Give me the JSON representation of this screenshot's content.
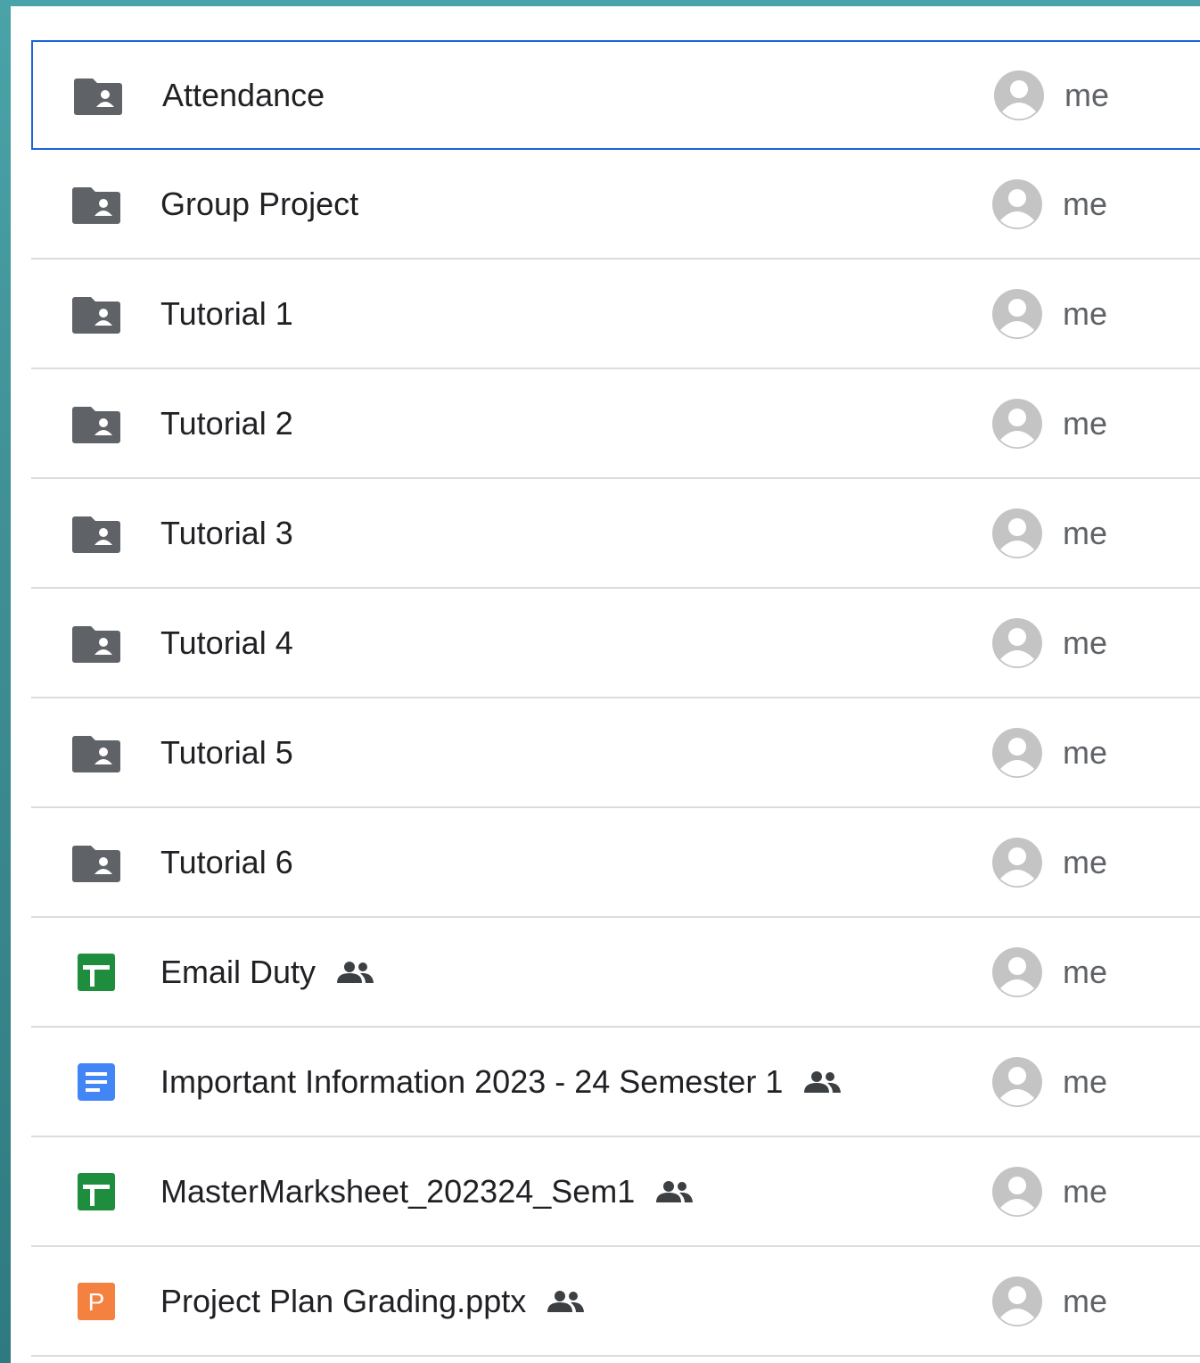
{
  "files": [
    {
      "name": "Attendance",
      "type": "shared-folder",
      "shared": false,
      "owner": "me",
      "selected": true
    },
    {
      "name": "Group Project",
      "type": "shared-folder",
      "shared": false,
      "owner": "me",
      "selected": false
    },
    {
      "name": "Tutorial 1",
      "type": "shared-folder",
      "shared": false,
      "owner": "me",
      "selected": false
    },
    {
      "name": "Tutorial 2",
      "type": "shared-folder",
      "shared": false,
      "owner": "me",
      "selected": false
    },
    {
      "name": "Tutorial 3",
      "type": "shared-folder",
      "shared": false,
      "owner": "me",
      "selected": false
    },
    {
      "name": "Tutorial 4",
      "type": "shared-folder",
      "shared": false,
      "owner": "me",
      "selected": false
    },
    {
      "name": "Tutorial 5",
      "type": "shared-folder",
      "shared": false,
      "owner": "me",
      "selected": false
    },
    {
      "name": "Tutorial 6",
      "type": "shared-folder",
      "shared": false,
      "owner": "me",
      "selected": false
    },
    {
      "name": "Email Duty",
      "type": "sheets",
      "shared": true,
      "owner": "me",
      "selected": false
    },
    {
      "name": "Important Information 2023 - 24 Semester 1",
      "type": "docs",
      "shared": true,
      "owner": "me",
      "selected": false
    },
    {
      "name": "MasterMarksheet_202324_Sem1",
      "type": "sheets",
      "shared": true,
      "owner": "me",
      "selected": false
    },
    {
      "name": "Project Plan Grading.pptx",
      "type": "slides",
      "shared": true,
      "owner": "me",
      "selected": false
    }
  ],
  "icons": {
    "shared-folder": "shared-folder-icon",
    "sheets": "google-sheets-icon",
    "docs": "google-docs-icon",
    "slides": "google-slides-icon",
    "shared": "shared-people-icon",
    "owner": "avatar-icon"
  },
  "colors": {
    "folder": "#5f6368",
    "sheets": "#1e8e3e",
    "docs": "#4285f4",
    "slides": "#f4813f",
    "selection": "#1a66d9",
    "avatar": "#c4c4c4"
  },
  "slides_letter": "P"
}
